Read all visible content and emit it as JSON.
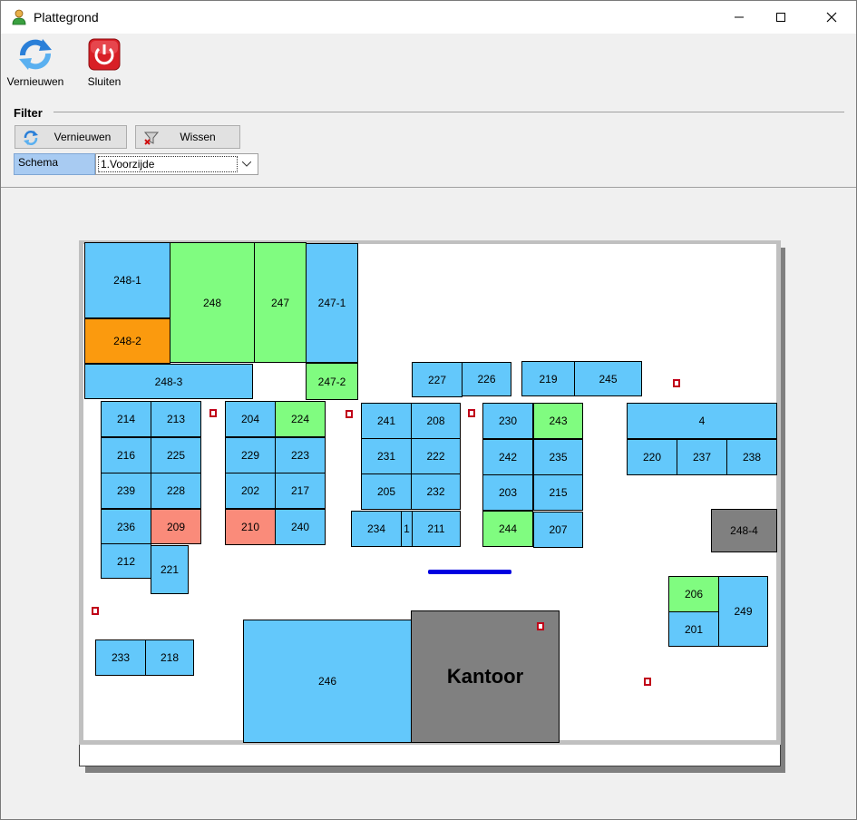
{
  "window": {
    "title": "Plattegrond",
    "controls": {
      "minimize": "—",
      "maximize": "☐",
      "close": "✕"
    }
  },
  "toolbar": {
    "refresh_label": "Vernieuwen",
    "close_label": "Sluiten"
  },
  "filter": {
    "title": "Filter",
    "refresh_label": "Vernieuwen",
    "clear_label": "Wissen",
    "schema_label": "Schema",
    "schema_value": "1.Voorzijde"
  },
  "colors": {
    "blue": "#63c8fb",
    "green": "#80fc80",
    "orange": "#fb9a0e",
    "salmon": "#fa8b7a",
    "gray": "#808080"
  },
  "floorplan": {
    "booths": [
      {
        "id": "248-1",
        "status": "blue"
      },
      {
        "id": "248",
        "status": "green"
      },
      {
        "id": "247",
        "status": "green"
      },
      {
        "id": "247-1",
        "status": "blue"
      },
      {
        "id": "248-2",
        "status": "orange"
      },
      {
        "id": "248-3",
        "status": "blue"
      },
      {
        "id": "247-2",
        "status": "green"
      },
      {
        "id": "227",
        "status": "blue"
      },
      {
        "id": "226",
        "status": "blue"
      },
      {
        "id": "219",
        "status": "blue"
      },
      {
        "id": "245",
        "status": "blue"
      },
      {
        "id": "214",
        "status": "blue"
      },
      {
        "id": "213",
        "status": "blue"
      },
      {
        "id": "204",
        "status": "blue"
      },
      {
        "id": "224",
        "status": "green"
      },
      {
        "id": "241",
        "status": "blue"
      },
      {
        "id": "208",
        "status": "blue"
      },
      {
        "id": "230",
        "status": "blue"
      },
      {
        "id": "243",
        "status": "green"
      },
      {
        "id": "4",
        "status": "blue"
      },
      {
        "id": "216",
        "status": "blue"
      },
      {
        "id": "225",
        "status": "blue"
      },
      {
        "id": "229",
        "status": "blue"
      },
      {
        "id": "223",
        "status": "blue"
      },
      {
        "id": "231",
        "status": "blue"
      },
      {
        "id": "222",
        "status": "blue"
      },
      {
        "id": "242",
        "status": "blue"
      },
      {
        "id": "235",
        "status": "blue"
      },
      {
        "id": "220",
        "status": "blue"
      },
      {
        "id": "237",
        "status": "blue"
      },
      {
        "id": "238",
        "status": "blue"
      },
      {
        "id": "239",
        "status": "blue"
      },
      {
        "id": "228",
        "status": "blue"
      },
      {
        "id": "202",
        "status": "blue"
      },
      {
        "id": "217",
        "status": "blue"
      },
      {
        "id": "205",
        "status": "blue"
      },
      {
        "id": "232",
        "status": "blue"
      },
      {
        "id": "203",
        "status": "blue"
      },
      {
        "id": "215",
        "status": "blue"
      },
      {
        "id": "236",
        "status": "blue"
      },
      {
        "id": "209",
        "status": "salmon"
      },
      {
        "id": "210",
        "status": "salmon"
      },
      {
        "id": "240",
        "status": "blue"
      },
      {
        "id": "234",
        "status": "blue"
      },
      {
        "id": "1",
        "status": "blue"
      },
      {
        "id": "211",
        "status": "blue"
      },
      {
        "id": "244",
        "status": "green"
      },
      {
        "id": "207",
        "status": "blue"
      },
      {
        "id": "248-4",
        "status": "gray"
      },
      {
        "id": "212",
        "status": "blue"
      },
      {
        "id": "221",
        "status": "blue"
      },
      {
        "id": "206",
        "status": "green"
      },
      {
        "id": "249",
        "status": "blue"
      },
      {
        "id": "201",
        "status": "blue"
      },
      {
        "id": "233",
        "status": "blue"
      },
      {
        "id": "218",
        "status": "blue"
      },
      {
        "id": "246",
        "status": "blue"
      },
      {
        "id": "Kantoor",
        "status": "gray"
      }
    ]
  }
}
